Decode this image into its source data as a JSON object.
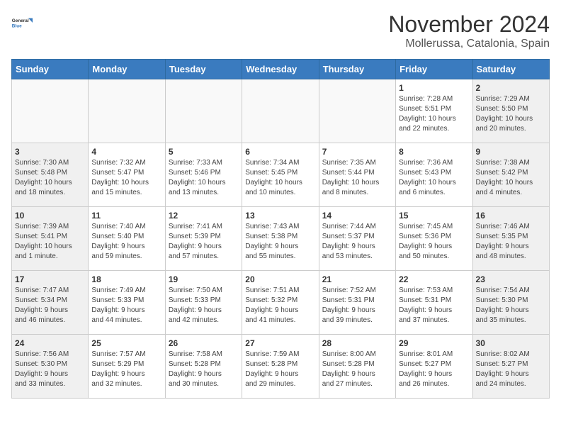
{
  "logo": {
    "line1": "General",
    "line2": "Blue"
  },
  "title": "November 2024",
  "location": "Mollerussa, Catalonia, Spain",
  "days_header": [
    "Sunday",
    "Monday",
    "Tuesday",
    "Wednesday",
    "Thursday",
    "Friday",
    "Saturday"
  ],
  "weeks": [
    [
      {
        "day": "",
        "info": ""
      },
      {
        "day": "",
        "info": ""
      },
      {
        "day": "",
        "info": ""
      },
      {
        "day": "",
        "info": ""
      },
      {
        "day": "",
        "info": ""
      },
      {
        "day": "1",
        "info": "Sunrise: 7:28 AM\nSunset: 5:51 PM\nDaylight: 10 hours\nand 22 minutes."
      },
      {
        "day": "2",
        "info": "Sunrise: 7:29 AM\nSunset: 5:50 PM\nDaylight: 10 hours\nand 20 minutes."
      }
    ],
    [
      {
        "day": "3",
        "info": "Sunrise: 7:30 AM\nSunset: 5:48 PM\nDaylight: 10 hours\nand 18 minutes."
      },
      {
        "day": "4",
        "info": "Sunrise: 7:32 AM\nSunset: 5:47 PM\nDaylight: 10 hours\nand 15 minutes."
      },
      {
        "day": "5",
        "info": "Sunrise: 7:33 AM\nSunset: 5:46 PM\nDaylight: 10 hours\nand 13 minutes."
      },
      {
        "day": "6",
        "info": "Sunrise: 7:34 AM\nSunset: 5:45 PM\nDaylight: 10 hours\nand 10 minutes."
      },
      {
        "day": "7",
        "info": "Sunrise: 7:35 AM\nSunset: 5:44 PM\nDaylight: 10 hours\nand 8 minutes."
      },
      {
        "day": "8",
        "info": "Sunrise: 7:36 AM\nSunset: 5:43 PM\nDaylight: 10 hours\nand 6 minutes."
      },
      {
        "day": "9",
        "info": "Sunrise: 7:38 AM\nSunset: 5:42 PM\nDaylight: 10 hours\nand 4 minutes."
      }
    ],
    [
      {
        "day": "10",
        "info": "Sunrise: 7:39 AM\nSunset: 5:41 PM\nDaylight: 10 hours\nand 1 minute."
      },
      {
        "day": "11",
        "info": "Sunrise: 7:40 AM\nSunset: 5:40 PM\nDaylight: 9 hours\nand 59 minutes."
      },
      {
        "day": "12",
        "info": "Sunrise: 7:41 AM\nSunset: 5:39 PM\nDaylight: 9 hours\nand 57 minutes."
      },
      {
        "day": "13",
        "info": "Sunrise: 7:43 AM\nSunset: 5:38 PM\nDaylight: 9 hours\nand 55 minutes."
      },
      {
        "day": "14",
        "info": "Sunrise: 7:44 AM\nSunset: 5:37 PM\nDaylight: 9 hours\nand 53 minutes."
      },
      {
        "day": "15",
        "info": "Sunrise: 7:45 AM\nSunset: 5:36 PM\nDaylight: 9 hours\nand 50 minutes."
      },
      {
        "day": "16",
        "info": "Sunrise: 7:46 AM\nSunset: 5:35 PM\nDaylight: 9 hours\nand 48 minutes."
      }
    ],
    [
      {
        "day": "17",
        "info": "Sunrise: 7:47 AM\nSunset: 5:34 PM\nDaylight: 9 hours\nand 46 minutes."
      },
      {
        "day": "18",
        "info": "Sunrise: 7:49 AM\nSunset: 5:33 PM\nDaylight: 9 hours\nand 44 minutes."
      },
      {
        "day": "19",
        "info": "Sunrise: 7:50 AM\nSunset: 5:33 PM\nDaylight: 9 hours\nand 42 minutes."
      },
      {
        "day": "20",
        "info": "Sunrise: 7:51 AM\nSunset: 5:32 PM\nDaylight: 9 hours\nand 41 minutes."
      },
      {
        "day": "21",
        "info": "Sunrise: 7:52 AM\nSunset: 5:31 PM\nDaylight: 9 hours\nand 39 minutes."
      },
      {
        "day": "22",
        "info": "Sunrise: 7:53 AM\nSunset: 5:31 PM\nDaylight: 9 hours\nand 37 minutes."
      },
      {
        "day": "23",
        "info": "Sunrise: 7:54 AM\nSunset: 5:30 PM\nDaylight: 9 hours\nand 35 minutes."
      }
    ],
    [
      {
        "day": "24",
        "info": "Sunrise: 7:56 AM\nSunset: 5:30 PM\nDaylight: 9 hours\nand 33 minutes."
      },
      {
        "day": "25",
        "info": "Sunrise: 7:57 AM\nSunset: 5:29 PM\nDaylight: 9 hours\nand 32 minutes."
      },
      {
        "day": "26",
        "info": "Sunrise: 7:58 AM\nSunset: 5:28 PM\nDaylight: 9 hours\nand 30 minutes."
      },
      {
        "day": "27",
        "info": "Sunrise: 7:59 AM\nSunset: 5:28 PM\nDaylight: 9 hours\nand 29 minutes."
      },
      {
        "day": "28",
        "info": "Sunrise: 8:00 AM\nSunset: 5:28 PM\nDaylight: 9 hours\nand 27 minutes."
      },
      {
        "day": "29",
        "info": "Sunrise: 8:01 AM\nSunset: 5:27 PM\nDaylight: 9 hours\nand 26 minutes."
      },
      {
        "day": "30",
        "info": "Sunrise: 8:02 AM\nSunset: 5:27 PM\nDaylight: 9 hours\nand 24 minutes."
      }
    ]
  ]
}
